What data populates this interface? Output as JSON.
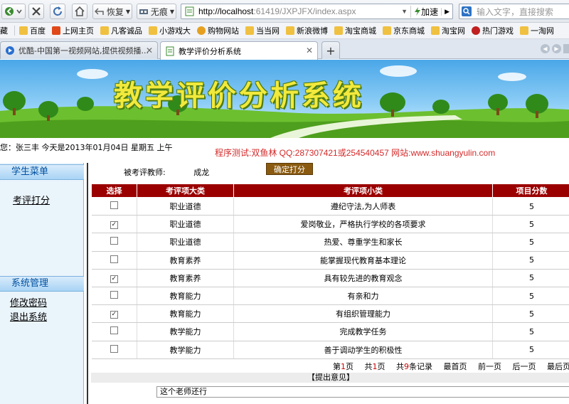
{
  "browser": {
    "back_label": "",
    "restore_label": "恢复",
    "noads_label": "无痕",
    "address_host": "http://localhost",
    "address_rest": ":61419/JXPJFX/index.aspx",
    "speedup_label": "加速",
    "search_placeholder": "输入文字，直接搜索",
    "favorites": [
      "藏",
      "百度",
      "上网主页",
      "凡客诚品",
      "小游戏大",
      "购物网站",
      "当当网",
      "新浪微博",
      "淘宝商城",
      "京东商城",
      "淘宝网",
      "热门游戏",
      "一淘网"
    ],
    "tabs": [
      {
        "label": "优酷-中国第一视频网站,提供视频播...",
        "active": false
      },
      {
        "label": "教学评价分析系统",
        "active": true
      }
    ]
  },
  "page": {
    "banner_title": "教学评价分析系统",
    "greeting": "您：张三丰    今天是2013年01月04日    星期五    上午",
    "ad_text": "程序测试:双鱼林 QQ:287307421或254540457 网站:www.shuangyulin.com"
  },
  "sidebar": {
    "student_menu": "学生菜单",
    "evaluate_link": "考评打分",
    "system_menu": "系统管理",
    "change_password": "修改密码",
    "logout": "退出系统"
  },
  "form": {
    "teacher_label": "被考评教师:",
    "teacher_name": "成龙",
    "confirm_button": "确定打分",
    "headers": [
      "选择",
      "考评项大类",
      "考评项小类",
      "项目分数"
    ],
    "rows": [
      {
        "checked": false,
        "category": "职业道德",
        "item": "遵纪守法,为人师表",
        "score": "5"
      },
      {
        "checked": true,
        "category": "职业道德",
        "item": "爱岗敬业，严格执行学校的各项要求",
        "score": "5"
      },
      {
        "checked": false,
        "category": "职业道德",
        "item": "热爱、尊重学生和家长",
        "score": "5"
      },
      {
        "checked": false,
        "category": "教育素养",
        "item": "能掌握现代教育基本理论",
        "score": "5"
      },
      {
        "checked": true,
        "category": "教育素养",
        "item": "具有较先进的教育观念",
        "score": "5"
      },
      {
        "checked": false,
        "category": "教育能力",
        "item": "有亲和力",
        "score": "5"
      },
      {
        "checked": true,
        "category": "教育能力",
        "item": "有组织管理能力",
        "score": "5"
      },
      {
        "checked": false,
        "category": "教学能力",
        "item": "完成教学任务",
        "score": "5"
      },
      {
        "checked": false,
        "category": "教学能力",
        "item": "善于调动学生的积极性",
        "score": "5"
      }
    ],
    "pager": {
      "page_prefix": "第",
      "page_num": "1",
      "page_suffix": "页",
      "total_prefix": "共",
      "total_num": "1",
      "total_suffix": "页",
      "records_prefix": "共",
      "records_num": "9",
      "records_suffix": "条记录",
      "first": "最首页",
      "prev": "前一页",
      "next": "后一页",
      "last": "最后页"
    },
    "opinion_header": "【提出意见】",
    "opinion_value": "这个老师还行"
  },
  "colors": {
    "header_red": "#9b0000",
    "ad_red": "#d42a2a",
    "banner_title": "#f2e93c",
    "sidebar_head": "#0050a0"
  }
}
